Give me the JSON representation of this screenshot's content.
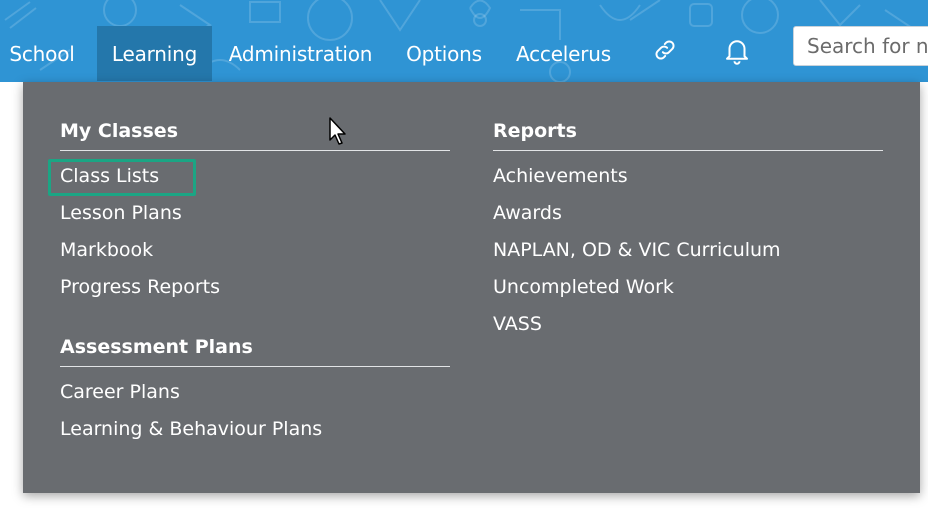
{
  "topnav": {
    "items": [
      {
        "label": "School",
        "active": false
      },
      {
        "label": "Learning",
        "active": true
      },
      {
        "label": "Administration",
        "active": false
      },
      {
        "label": "Options",
        "active": false
      },
      {
        "label": "Accelerus",
        "active": false
      }
    ],
    "icons": [
      "link-icon",
      "bell-icon"
    ],
    "search_placeholder": "Search for na"
  },
  "dropdown": {
    "left": {
      "sections": [
        {
          "heading": "My Classes",
          "items": [
            "Class Lists",
            "Lesson Plans",
            "Markbook",
            "Progress Reports"
          ]
        },
        {
          "heading": "Assessment Plans",
          "items": [
            "Career Plans",
            "Learning & Behaviour Plans"
          ]
        }
      ]
    },
    "right": {
      "sections": [
        {
          "heading": "Reports",
          "items": [
            "Achievements",
            "Awards",
            "NAPLAN, OD & VIC Curriculum",
            "Uncompleted Work",
            "VASS"
          ]
        }
      ]
    },
    "highlighted_item": "Class Lists"
  },
  "colors": {
    "topbar": "#2f94d4",
    "active_tab": "#2477ab",
    "dropdown_bg": "#696c70",
    "highlight": "#1ba584"
  }
}
